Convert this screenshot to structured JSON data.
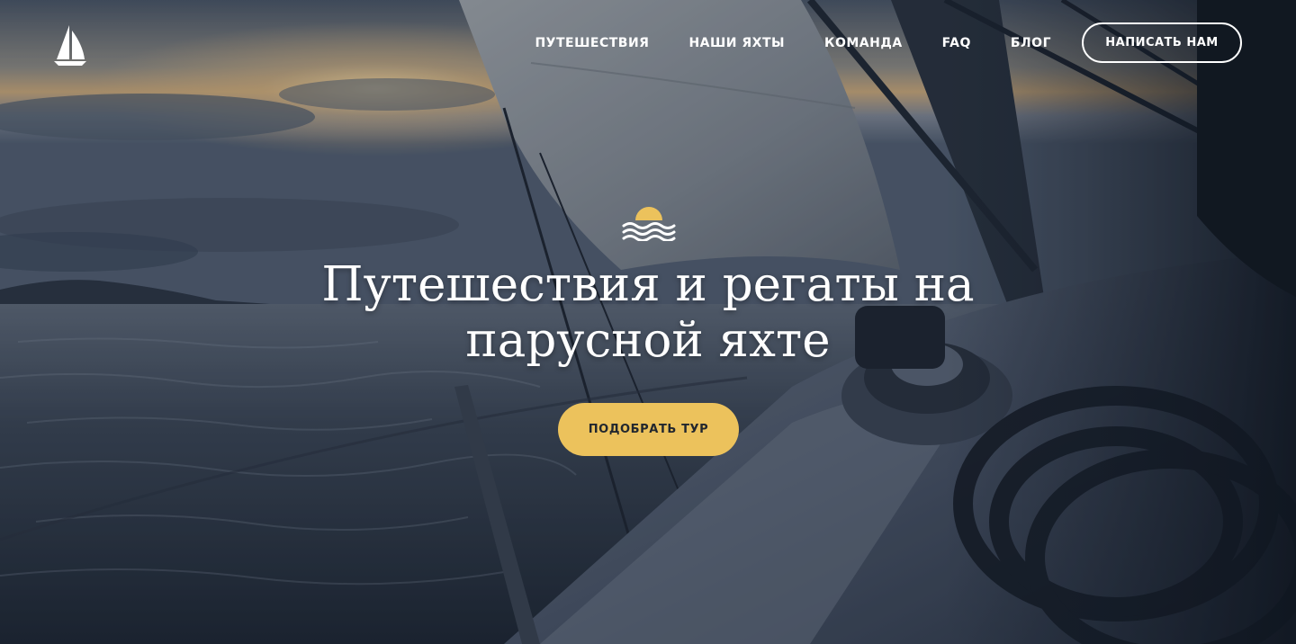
{
  "header": {
    "logo_icon": "sailboat-icon",
    "nav": [
      {
        "label": "ПУТЕШЕСТВИЯ"
      },
      {
        "label": "НАШИ ЯХТЫ"
      },
      {
        "label": "КОМАНДА"
      },
      {
        "label": "FAQ"
      },
      {
        "label": "БЛОГ"
      }
    ],
    "contact_label": "НАПИСАТЬ НАМ"
  },
  "hero": {
    "icon": "sun-over-waves-icon",
    "title": "Путешествия и регаты на парусной яхте",
    "cta_label": "ПОДОБРАТЬ ТУР",
    "background": "sailing-yacht-sunset-photo"
  },
  "colors": {
    "accent": "#ECC25C",
    "text": "#FFFFFF",
    "button_text": "#22272E"
  }
}
